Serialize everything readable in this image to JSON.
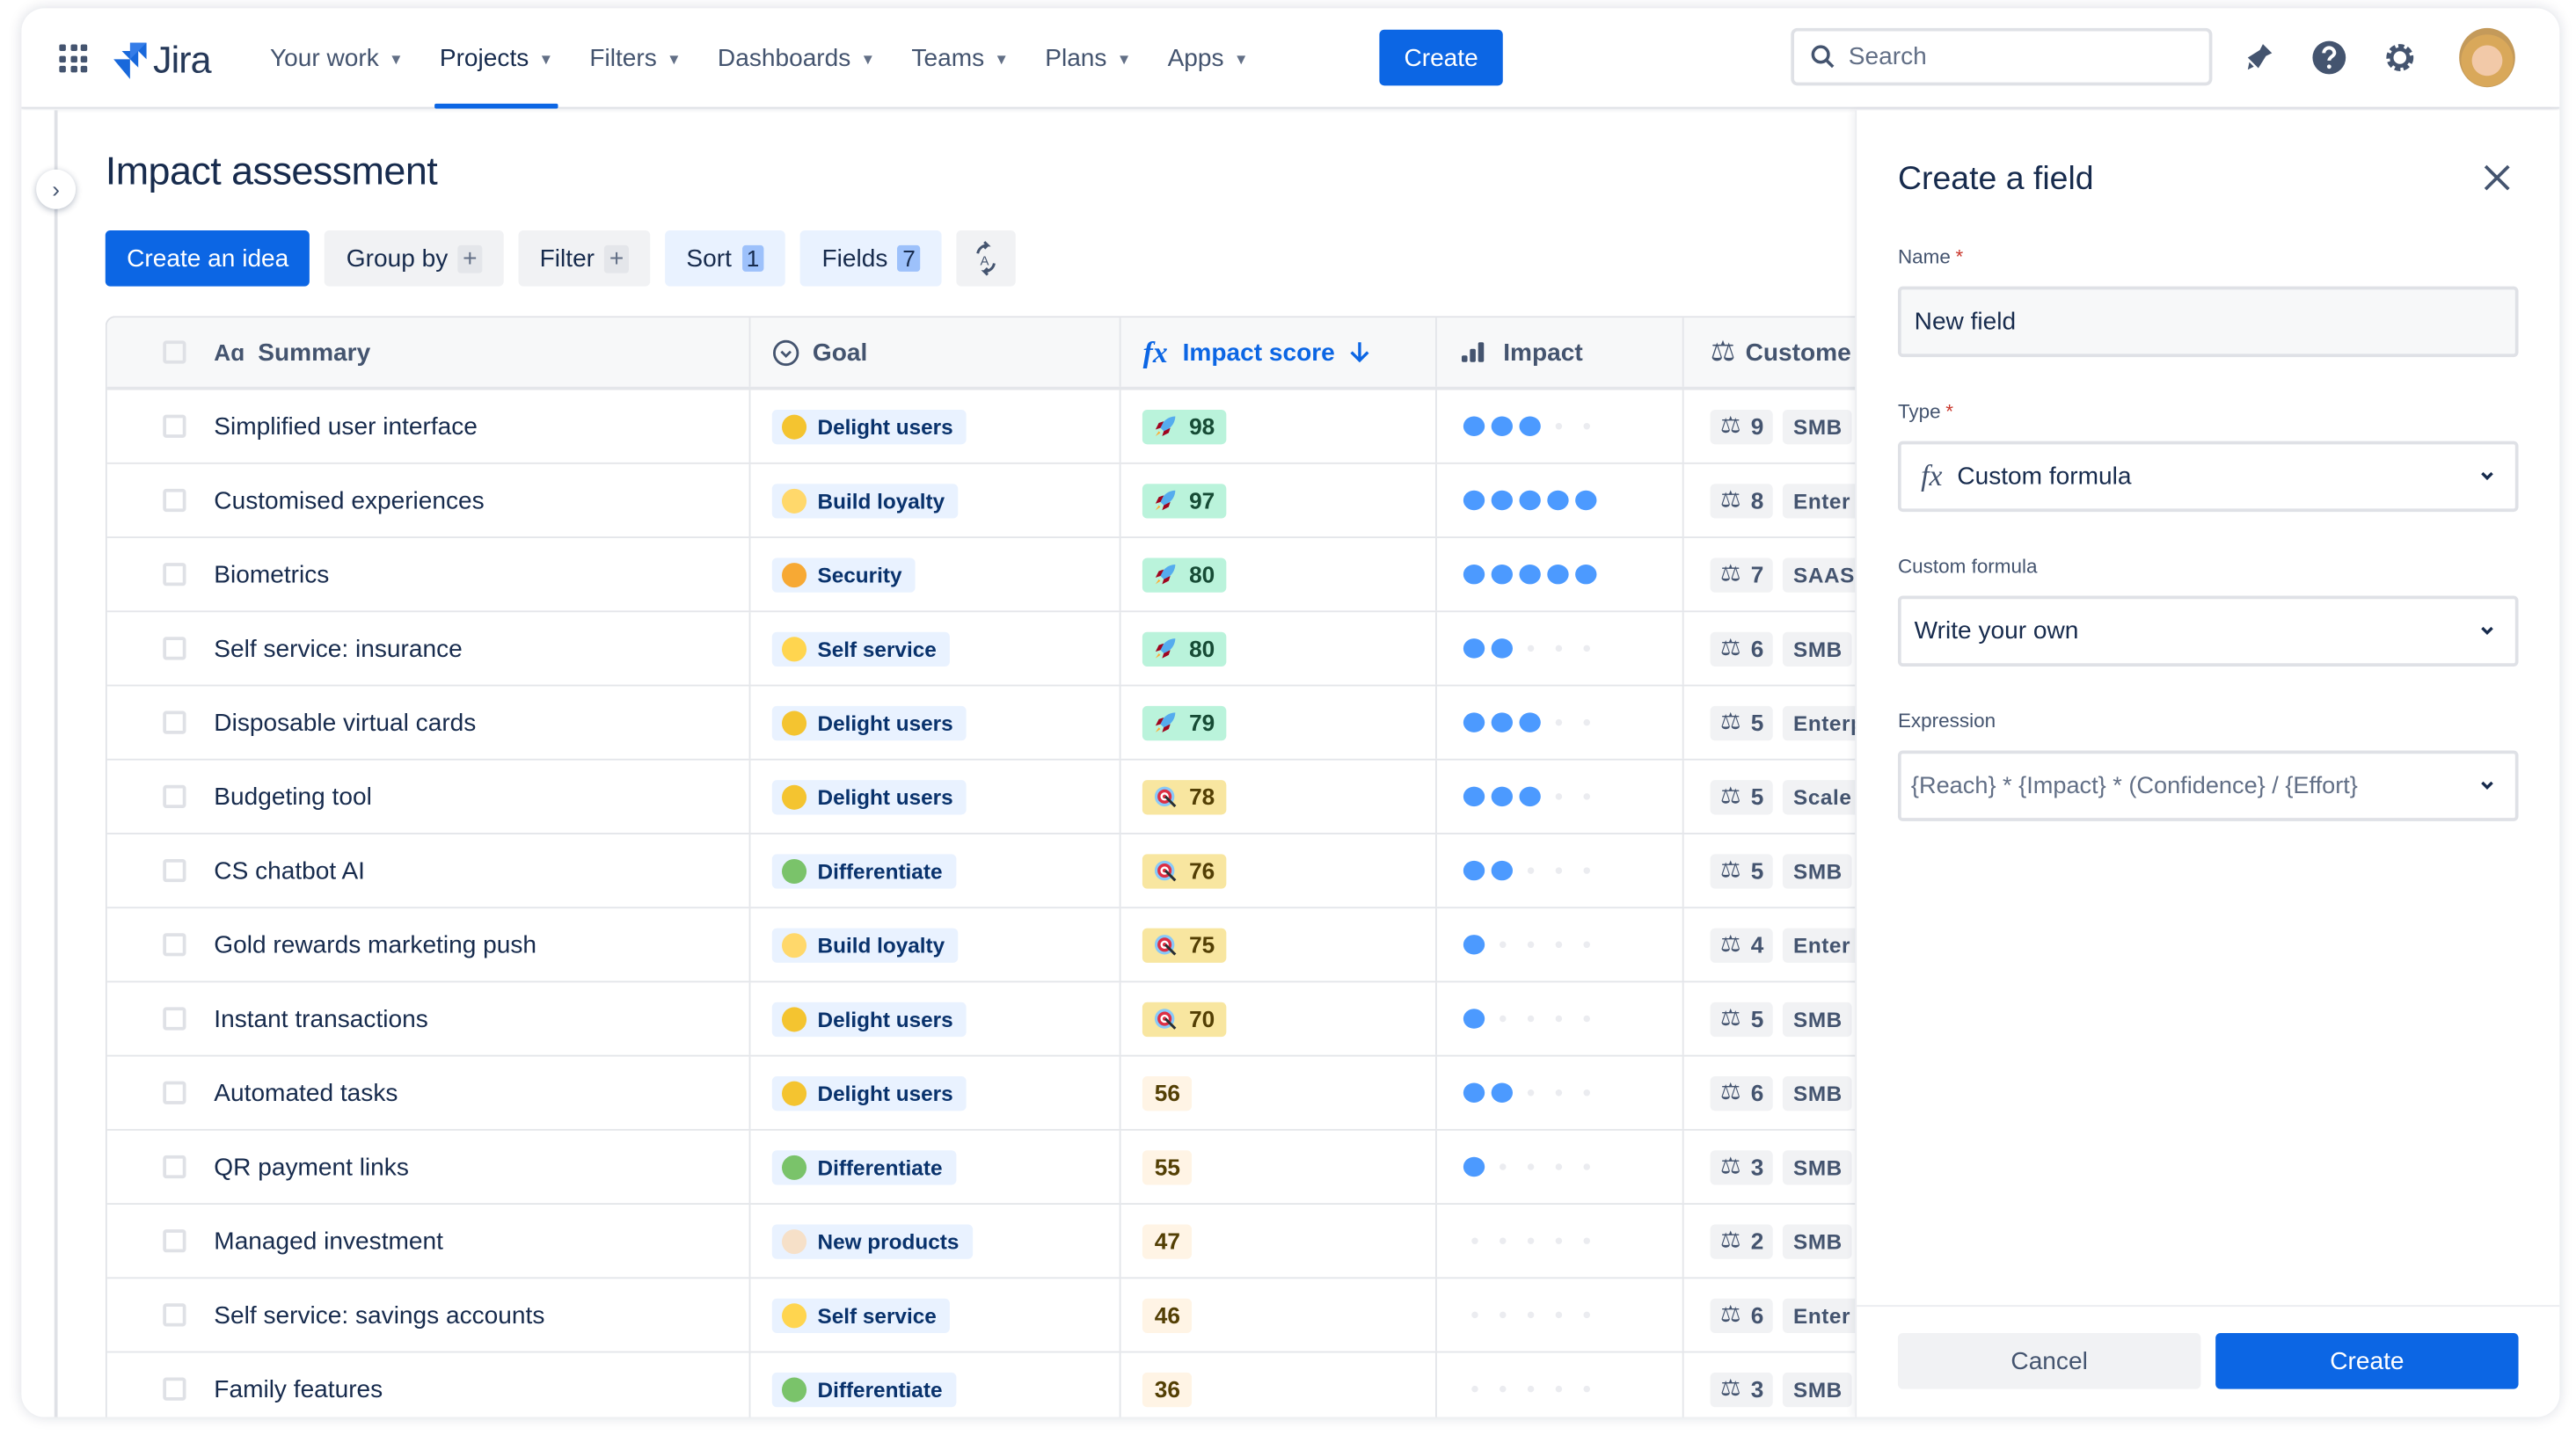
{
  "header": {
    "app_name": "Jira",
    "nav": [
      {
        "label": "Your work",
        "active": false
      },
      {
        "label": "Projects",
        "active": true
      },
      {
        "label": "Filters",
        "active": false
      },
      {
        "label": "Dashboards",
        "active": false
      },
      {
        "label": "Teams",
        "active": false
      },
      {
        "label": "Plans",
        "active": false
      },
      {
        "label": "Apps",
        "active": false
      }
    ],
    "create_label": "Create",
    "search_placeholder": "Search",
    "icons": [
      "notifications-icon",
      "help-icon",
      "settings-icon",
      "avatar"
    ]
  },
  "page": {
    "title": "Impact assessment",
    "toolbar": {
      "create_idea": "Create an idea",
      "group_by": "Group by",
      "filter": "Filter",
      "sort": "Sort",
      "sort_count": "1",
      "fields": "Fields",
      "fields_count": "7"
    }
  },
  "table": {
    "columns": [
      "Summary",
      "Goal",
      "Impact score",
      "Impact",
      "Custome"
    ],
    "sort_column": "Impact score",
    "sort_direction": "descending",
    "goal_colors": {
      "Delight users": "#f4c430",
      "Build loyalty": "#ffd86b",
      "Security": "#f7a934",
      "Self service": "#ffd54f",
      "Differentiate": "#7ac36a",
      "New products": "#f6e0c8"
    },
    "rows": [
      {
        "summary": "Simplified user interface",
        "goal": "Delight users",
        "score": "98",
        "score_level": "hi",
        "impact": 3,
        "customers": "9",
        "segment": "SMB"
      },
      {
        "summary": "Customised experiences",
        "goal": "Build loyalty",
        "score": "97",
        "score_level": "hi",
        "impact": 5,
        "customers": "8",
        "segment": "Enter"
      },
      {
        "summary": "Biometrics",
        "goal": "Security",
        "score": "80",
        "score_level": "hi",
        "impact": 5,
        "customers": "7",
        "segment": "SAAS"
      },
      {
        "summary": "Self service: insurance",
        "goal": "Self service",
        "score": "80",
        "score_level": "hi",
        "impact": 2,
        "customers": "6",
        "segment": "SMB"
      },
      {
        "summary": "Disposable virtual cards",
        "goal": "Delight users",
        "score": "79",
        "score_level": "hi",
        "impact": 3,
        "customers": "5",
        "segment": "Enterp"
      },
      {
        "summary": "Budgeting tool",
        "goal": "Delight users",
        "score": "78",
        "score_level": "mid",
        "impact": 3,
        "customers": "5",
        "segment": "Scale"
      },
      {
        "summary": "CS chatbot AI",
        "goal": "Differentiate",
        "score": "76",
        "score_level": "mid",
        "impact": 2,
        "customers": "5",
        "segment": "SMB"
      },
      {
        "summary": "Gold rewards marketing push",
        "goal": "Build loyalty",
        "score": "75",
        "score_level": "mid",
        "impact": 1,
        "customers": "4",
        "segment": "Enter"
      },
      {
        "summary": "Instant transactions",
        "goal": "Delight users",
        "score": "70",
        "score_level": "mid",
        "impact": 1,
        "customers": "5",
        "segment": "SMB"
      },
      {
        "summary": "Automated tasks",
        "goal": "Delight users",
        "score": "56",
        "score_level": "lo",
        "impact": 2,
        "customers": "6",
        "segment": "SMB"
      },
      {
        "summary": "QR payment links",
        "goal": "Differentiate",
        "score": "55",
        "score_level": "lo",
        "impact": 1,
        "customers": "3",
        "segment": "SMB"
      },
      {
        "summary": "Managed investment",
        "goal": "New products",
        "score": "47",
        "score_level": "lo",
        "impact": 0,
        "customers": "2",
        "segment": "SMB"
      },
      {
        "summary": "Self service: savings accounts",
        "goal": "Self service",
        "score": "46",
        "score_level": "lo",
        "impact": 0,
        "customers": "6",
        "segment": "Enter"
      },
      {
        "summary": "Family features",
        "goal": "Differentiate",
        "score": "36",
        "score_level": "lo",
        "impact": 0,
        "customers": "3",
        "segment": "SMB"
      }
    ]
  },
  "panel": {
    "title": "Create a field",
    "name_label": "Name",
    "name_value": "New field",
    "type_label": "Type",
    "type_value": "Custom formula",
    "formula_label": "Custom formula",
    "formula_value": "Write your own",
    "expression_label": "Expression",
    "expression_value": "{Reach} * {Impact} * (Confidence} / {Effort}",
    "required_mark": "*",
    "cancel_label": "Cancel",
    "create_label": "Create"
  },
  "colors": {
    "accent": "#0c66e4",
    "impact_dot": "#4c9aff",
    "score_high": "#baf3db",
    "score_mid": "#f8e6a0"
  }
}
